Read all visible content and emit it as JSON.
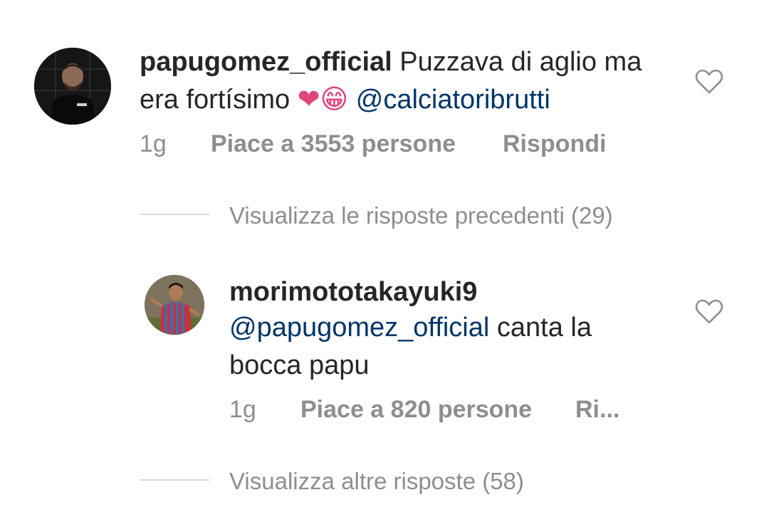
{
  "comment": {
    "username": "papugomez_official",
    "text_before": " Puzzava di aglio ma era fortísimo ",
    "emojis": "❤😁",
    "mention": "@calciatoribrutti",
    "time": "1g",
    "likes": "Piace a 3553 persone",
    "reply": "Rispondi"
  },
  "view_previous": "Visualizza le risposte precedenti (29)",
  "reply": {
    "username": "morimototakayuki9",
    "mention": "@papugomez_official",
    "text": " canta la bocca papu",
    "time": "1g",
    "likes": "Piace a 820 persone",
    "reply": "Ri..."
  },
  "view_more": "Visualizza altre risposte (58)",
  "icons": {
    "heart": "heart-outline-icon"
  },
  "colors": {
    "text": "#262626",
    "muted": "#8e8e8e",
    "mention": "#003569",
    "divider": "#dbdbdb"
  }
}
